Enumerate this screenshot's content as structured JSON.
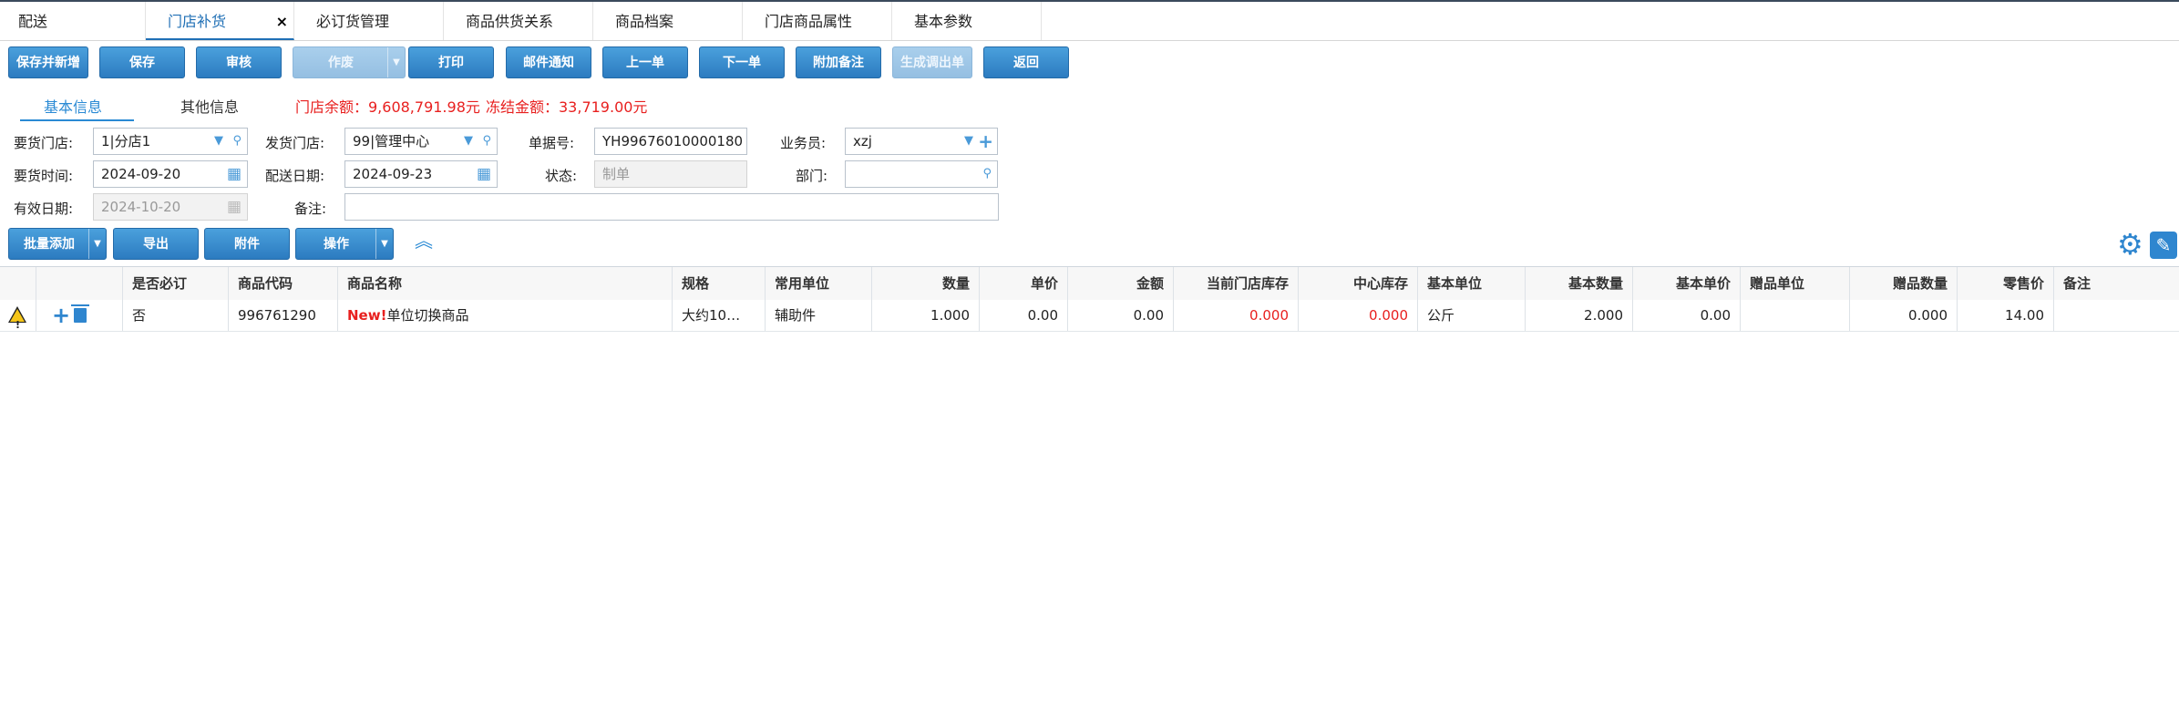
{
  "tabs": [
    {
      "label": "配送",
      "active": false
    },
    {
      "label": "门店补货",
      "active": true,
      "closable": true
    },
    {
      "label": "必订货管理",
      "active": false
    },
    {
      "label": "商品供货关系",
      "active": false
    },
    {
      "label": "商品档案",
      "active": false
    },
    {
      "label": "门店商品属性",
      "active": false
    },
    {
      "label": "基本参数",
      "active": false
    }
  ],
  "close_glyph": "×",
  "toolbar": {
    "save_new": "保存并新增",
    "save": "保存",
    "audit": "审核",
    "void": "作废",
    "print": "打印",
    "email": "邮件通知",
    "prev": "上一单",
    "next": "下一单",
    "add_note": "附加备注",
    "gen_transfer": "生成调出单",
    "back": "返回"
  },
  "subtabs": {
    "basic": "基本信息",
    "other": "其他信息"
  },
  "summary": {
    "store_balance": "门店余额：9,608,791.98元",
    "frozen": "冻结金额：33,719.00元"
  },
  "form": {
    "req_store_label": "要货门店:",
    "req_store_value": "1|分店1",
    "ship_store_label": "发货门店:",
    "ship_store_value": "99|管理中心",
    "doc_no_label": "单据号:",
    "doc_no_value": "YH99676010000180",
    "salesman_label": "业务员:",
    "salesman_value": "xzj",
    "req_time_label": "要货时间:",
    "req_time_value": "2024-09-20",
    "delivery_date_label": "配送日期:",
    "delivery_date_value": "2024-09-23",
    "status_label": "状态:",
    "status_placeholder": "制单",
    "dept_label": "部门:",
    "dept_value": "",
    "valid_date_label": "有效日期:",
    "valid_date_value": "2024-10-20",
    "note_label": "备注:",
    "note_value": ""
  },
  "actions": {
    "batch_add": "批量添加",
    "export": "导出",
    "attach": "附件",
    "operate": "操作"
  },
  "icons": {
    "search": "search-icon",
    "calendar": "calendar-icon",
    "dropdown": "chevron-down-icon",
    "add": "plus-icon",
    "collapse": "double-chevron-up-icon",
    "settings": "gear-icon",
    "edit": "pencil-icon",
    "warning": "warning-icon",
    "delete": "trash-icon"
  },
  "glyphs": {
    "calendar": "▦",
    "search": "⚲",
    "dropdown": "▼",
    "caret": "▼",
    "plus": "+",
    "collapse": "︽",
    "gear": "⚙",
    "edit": "✎",
    "warn": "!"
  },
  "grid": {
    "columns": [
      "是否必订",
      "商品代码",
      "商品名称",
      "规格",
      "常用单位",
      "数量",
      "单价",
      "金额",
      "当前门店库存",
      "中心库存",
      "基本单位",
      "基本数量",
      "基本单价",
      "赠品单位",
      "赠品数量",
      "零售价",
      "备注"
    ],
    "rows": [
      {
        "required": "否",
        "code": "996761290",
        "name_badge": "New!",
        "name": "单位切换商品",
        "spec": "大约10…",
        "unit": "辅助件",
        "qty": "1.000",
        "price": "0.00",
        "amount": "0.00",
        "store_stock": "0.000",
        "center_stock": "0.000",
        "base_unit": "公斤",
        "base_qty": "2.000",
        "base_price": "0.00",
        "gift_unit": "",
        "gift_qty": "0.000",
        "retail": "14.00",
        "note": ""
      }
    ]
  },
  "colors": {
    "primary": "#2c7bc0",
    "accent_text": "#2a8ad4",
    "alert": "#e8201f"
  }
}
